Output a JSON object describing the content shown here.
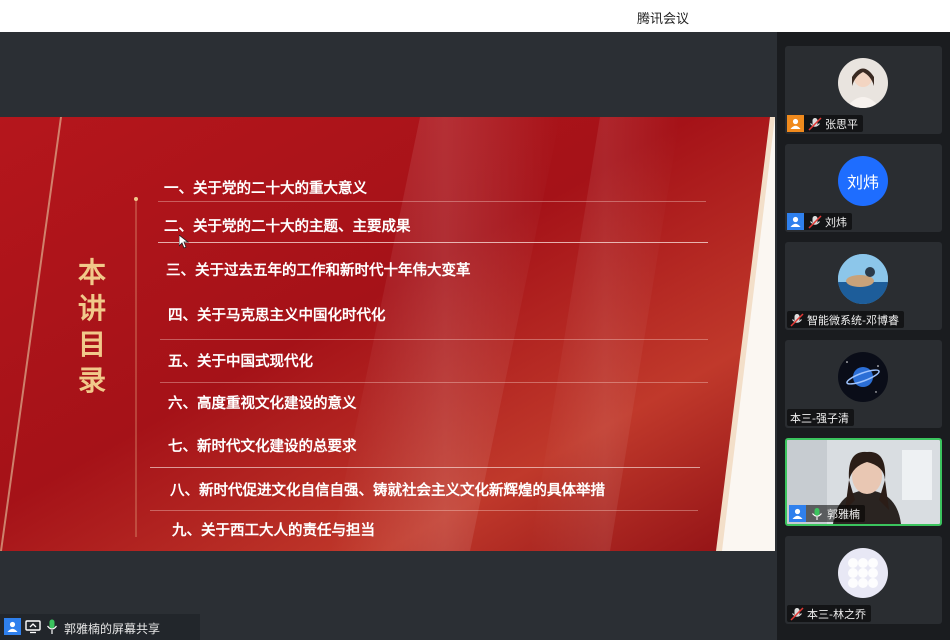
{
  "window": {
    "title": "腾讯会议"
  },
  "slide": {
    "toc_title": "本讲目录",
    "items": [
      "一、关于党的二十大的重大意义",
      "二、关于党的二十大的主题、主要成果",
      "三、关于过去五年的工作和新时代十年伟大变革",
      "四、关于马克思主义中国化时代化",
      "五、关于中国式现代化",
      "六、高度重视文化建设的意义",
      "七、新时代文化建设的总要求",
      "八、新时代促进文化自信自强、铸就社会主义文化新辉煌的具体举措",
      "九、关于西工大人的责任与担当"
    ]
  },
  "share": {
    "label": "郭雅楠的屏幕共享"
  },
  "participants": [
    {
      "name": "张思平",
      "avatar": "photo-avatar",
      "role": "host"
    },
    {
      "name": "刘炜",
      "avatar_text": "刘炜",
      "avatar_color": "#1e6dff",
      "role": "user"
    },
    {
      "name": "智能微系统-邓博睿",
      "avatar": "photo-avatar"
    },
    {
      "name": "本三-强子清",
      "avatar": "planet-avatar"
    },
    {
      "name": "郭雅楠",
      "avatar": "video",
      "role": "user",
      "speaking": true
    },
    {
      "name": "本三-林之乔",
      "avatar": "default-avatar"
    }
  ],
  "colors": {
    "slide_red": "#a8141a",
    "gold": "#f1c98a",
    "active_border": "#3bc45e",
    "accent_blue": "#2f80ed"
  }
}
